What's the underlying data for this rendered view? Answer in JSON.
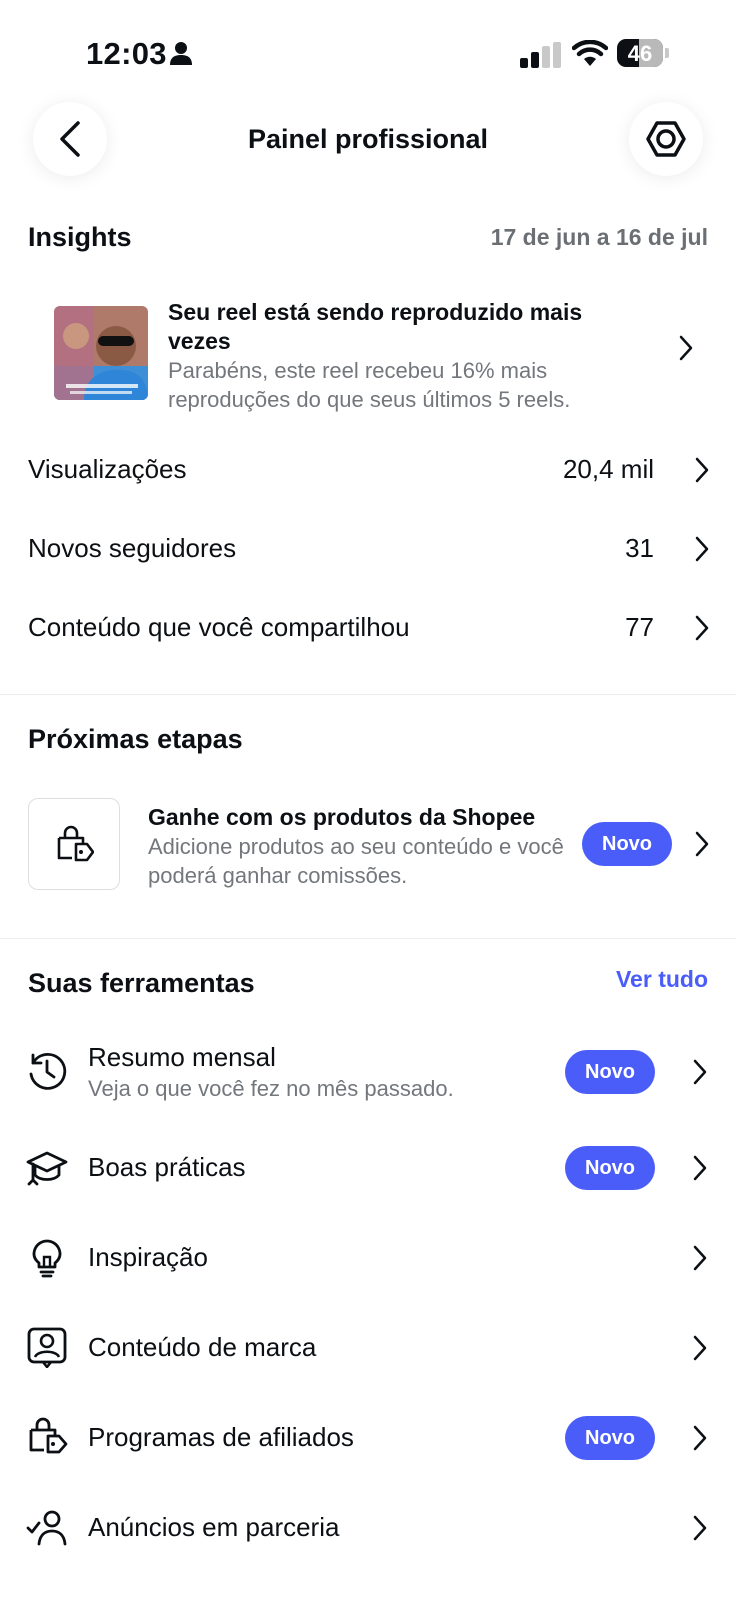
{
  "status_bar": {
    "time": "12:03",
    "battery": "46"
  },
  "header": {
    "title": "Painel profissional"
  },
  "insights": {
    "title": "Insights",
    "date_range": "17 de jun a 16 de jul",
    "reel": {
      "title": "Seu reel está sendo reproduzido mais vezes",
      "description": "Parabéns, este reel recebeu 16% mais reproduções do que seus últimos 5 reels."
    },
    "metrics": [
      {
        "label": "Visualizações",
        "value": "20,4 mil"
      },
      {
        "label": "Novos seguidores",
        "value": "31"
      },
      {
        "label": "Conteúdo que você compartilhou",
        "value": "77"
      }
    ]
  },
  "next_steps": {
    "title": "Próximas etapas",
    "item": {
      "title": "Ganhe com os produtos da Shopee",
      "description": "Adicione produtos ao seu conteúdo e você poderá ganhar comissões.",
      "badge": "Novo"
    }
  },
  "tools": {
    "title": "Suas ferramentas",
    "see_all": "Ver tudo",
    "items": [
      {
        "icon": "history-icon",
        "label": "Resumo mensal",
        "sublabel": "Veja o que você fez no mês passado.",
        "badge": "Novo"
      },
      {
        "icon": "graduation-cap-icon",
        "label": "Boas práticas",
        "badge": "Novo"
      },
      {
        "icon": "lightbulb-icon",
        "label": "Inspiração"
      },
      {
        "icon": "branded-content-icon",
        "label": "Conteúdo de marca"
      },
      {
        "icon": "shopping-bag-tag-icon",
        "label": "Programas de afiliados",
        "badge": "Novo"
      },
      {
        "icon": "partnership-ads-icon",
        "label": "Anúncios em parceria"
      }
    ]
  },
  "colors": {
    "accent": "#4a5df9",
    "text": "#0c1014",
    "secondary_text": "#73777c",
    "divider": "#ececec"
  }
}
